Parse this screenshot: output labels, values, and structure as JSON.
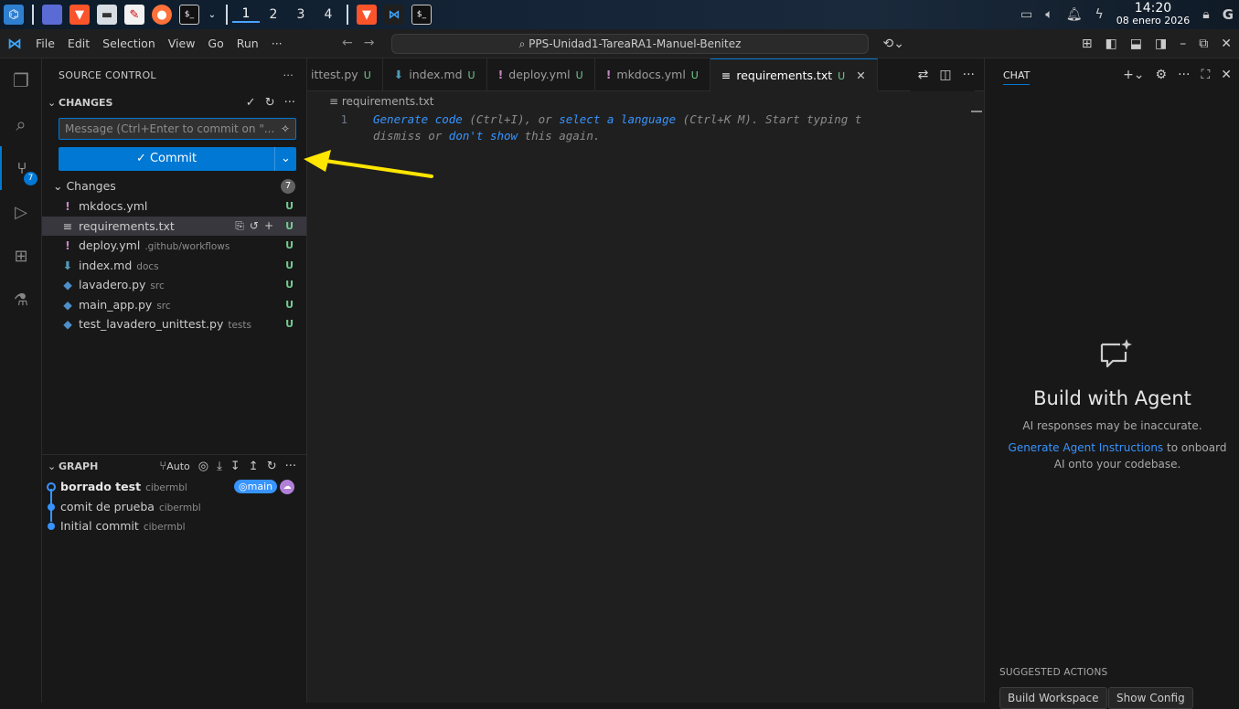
{
  "taskbar": {
    "workspaces": [
      "1",
      "2",
      "3",
      "4"
    ],
    "active_workspace": "1",
    "clock_time": "14:20",
    "clock_date": "08 enero 2026"
  },
  "titlebar": {
    "menu": [
      "File",
      "Edit",
      "Selection",
      "View",
      "Go",
      "Run",
      "···"
    ],
    "command_center": "PPS-Unidad1-TareaRA1-Manuel-Benitez"
  },
  "activity": {
    "scm_badge": "7"
  },
  "sidebar": {
    "title": "SOURCE CONTROL",
    "changes_header": "CHANGES",
    "commit_placeholder": "Message (Ctrl+Enter to commit on \"...",
    "commit_label": "Commit",
    "group_label": "Changes",
    "group_count": "7",
    "files": [
      {
        "name": "mkdocs.yml",
        "dir": "",
        "status": "U",
        "icon": "exclamation-icon"
      },
      {
        "name": "requirements.txt",
        "dir": "",
        "status": "U",
        "icon": "lines-icon"
      },
      {
        "name": "deploy.yml",
        "dir": ".github/workflows",
        "status": "U",
        "icon": "exclamation-icon"
      },
      {
        "name": "index.md",
        "dir": "docs",
        "status": "U",
        "icon": "markdown-icon"
      },
      {
        "name": "lavadero.py",
        "dir": "src",
        "status": "U",
        "icon": "python-icon"
      },
      {
        "name": "main_app.py",
        "dir": "src",
        "status": "U",
        "icon": "python-icon"
      },
      {
        "name": "test_lavadero_unittest.py",
        "dir": "tests",
        "status": "U",
        "icon": "python-icon"
      }
    ],
    "graph_header": "GRAPH",
    "graph_auto": "Auto",
    "commits": [
      {
        "message": "borrado test",
        "author": "cibermbl",
        "branch": "main"
      },
      {
        "message": "comit de prueba",
        "author": "cibermbl"
      },
      {
        "message": "Initial commit",
        "author": "cibermbl"
      }
    ]
  },
  "editor": {
    "tabs": [
      {
        "label": "ittest.py",
        "status": "U",
        "icon": "python-icon"
      },
      {
        "label": "index.md",
        "status": "U",
        "icon": "markdown-icon"
      },
      {
        "label": "deploy.yml",
        "status": "U",
        "icon": "exclamation-icon"
      },
      {
        "label": "mkdocs.yml",
        "status": "U",
        "icon": "exclamation-icon"
      },
      {
        "label": "requirements.txt",
        "status": "U",
        "icon": "lines-icon"
      }
    ],
    "breadcrumb": "requirements.txt",
    "line_number": "1",
    "hint": {
      "generate": "Generate code",
      "ctrl_i": " (Ctrl+I), or ",
      "select_lang": "select a language",
      "ctrl_k": " (Ctrl+K M). Start typing t",
      "dismiss": "dismiss or ",
      "dont_show": "don't show",
      "again": " this again."
    }
  },
  "chat": {
    "title": "CHAT",
    "agent_title": "Build with Agent",
    "agent_subtitle": "AI responses may be inaccurate.",
    "agent_link": "Generate Agent Instructions",
    "agent_desc_rest": " to onboard AI onto your codebase.",
    "suggested_header": "SUGGESTED ACTIONS",
    "suggested": [
      "Build Workspace",
      "Show Config"
    ]
  },
  "colors": {
    "accent": "#0078d4",
    "untracked": "#73c991",
    "arrow": "#ffe600"
  }
}
